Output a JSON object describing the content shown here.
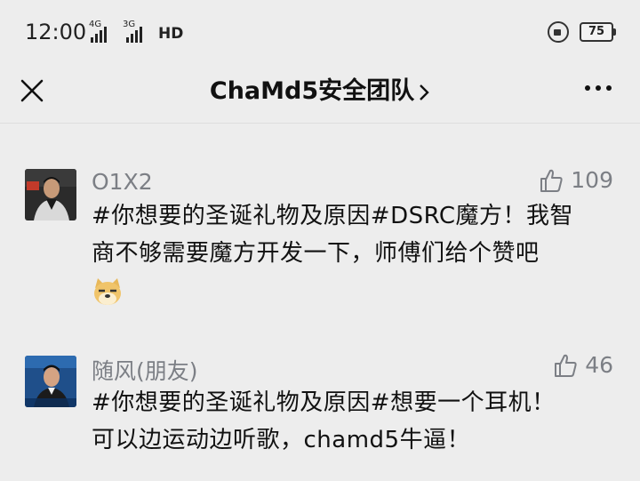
{
  "status": {
    "time": "12:00",
    "net1": "4G",
    "net2": "3G",
    "hd": "HD",
    "battery": "75"
  },
  "nav": {
    "title": "ChaMd5安全团队"
  },
  "comments": [
    {
      "name": "O1X2",
      "likes": "109",
      "text_line1": "#你想要的圣诞礼物及原因#DSRC魔方！我智",
      "text_line2": "商不够需要魔方开发一下，师傅们给个赞吧",
      "emoji": "doge-emoji"
    },
    {
      "name": "随风(朋友)",
      "likes": "46",
      "text_line1": "#你想要的圣诞礼物及原因#想要一个耳机！",
      "text_line2": "可以边运动边听歌，chamd5牛逼！"
    }
  ],
  "colors": {
    "background": "#ededed",
    "secondary_text": "#7c7f85",
    "primary_text": "#111111"
  }
}
